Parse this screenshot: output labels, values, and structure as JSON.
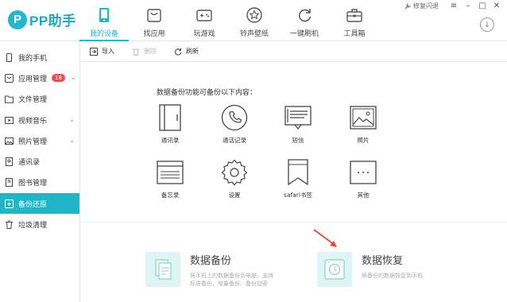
{
  "app": {
    "logo_mark": "P",
    "logo_text": "PP助手"
  },
  "nav": [
    {
      "label": "我的设备",
      "icon": "phone-icon",
      "active": true
    },
    {
      "label": "找应用",
      "icon": "bag-icon"
    },
    {
      "label": "玩游戏",
      "icon": "gamepad-icon"
    },
    {
      "label": "铃声壁纸",
      "icon": "star-icon"
    },
    {
      "label": "一键刷机",
      "icon": "refresh-icon"
    },
    {
      "label": "工具箱",
      "icon": "toolbox-icon"
    }
  ],
  "window": {
    "flash_label": "修复闪退",
    "menu": "≡",
    "minimize": "–",
    "maximize": "□",
    "close": "✕",
    "download_icon": "↓"
  },
  "sidebar": [
    {
      "label": "我的手机",
      "icon": "phone-icon"
    },
    {
      "label": "应用管理",
      "icon": "app-icon",
      "badge": "18",
      "chevron": "⌄"
    },
    {
      "label": "文件管理",
      "icon": "folder-icon"
    },
    {
      "label": "视频音乐",
      "icon": "video-icon",
      "chevron": "⌄"
    },
    {
      "label": "照片管理",
      "icon": "photo-icon",
      "chevron": "⌄"
    },
    {
      "label": "通讯录",
      "icon": "contacts-icon"
    },
    {
      "label": "图书管理",
      "icon": "book-icon"
    },
    {
      "label": "备份还原",
      "icon": "backup-icon",
      "active": true
    },
    {
      "label": "垃圾清理",
      "icon": "trash-icon"
    }
  ],
  "toolbar": {
    "import_label": "导入",
    "delete_label": "删除",
    "refresh_label": "刷新"
  },
  "main": {
    "intro": "数据备份功能可备份以下内容：",
    "items": [
      {
        "label": "通讯录",
        "icon": "address-book-icon"
      },
      {
        "label": "通话记录",
        "icon": "call-log-icon"
      },
      {
        "label": "短信",
        "icon": "sms-icon"
      },
      {
        "label": "照片",
        "icon": "photos-icon"
      },
      {
        "label": "备忘录",
        "icon": "memo-icon"
      },
      {
        "label": "设置",
        "icon": "settings-icon"
      },
      {
        "label": "safari书签",
        "icon": "bookmark-icon"
      },
      {
        "label": "其他",
        "icon": "more-icon"
      }
    ],
    "backup": {
      "title": "数据备份",
      "desc": "将手机上的数据备份到电脑，支持标准备份、增量备份、备份加密"
    },
    "restore": {
      "title": "数据恢复",
      "desc": "将备份的数据恢复到手机"
    }
  },
  "colors": {
    "accent": "#1fb6c8",
    "badge": "#f44c4c",
    "arrow": "#e8473a",
    "tile": "#dff5f3"
  }
}
